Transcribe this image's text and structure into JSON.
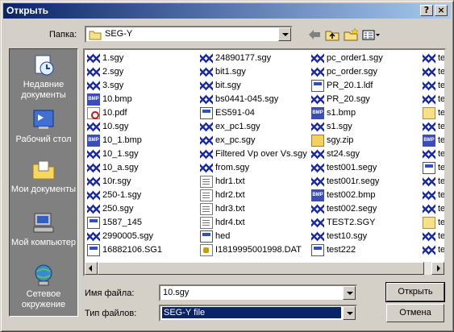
{
  "window": {
    "title": "Открыть",
    "help_label": "?",
    "close_label": "×"
  },
  "toolbar": {
    "lookin_label": "Папка:",
    "lookin_value": "SEG-Y"
  },
  "places": [
    {
      "label": "Недавние документы",
      "icon": "recent-docs-icon"
    },
    {
      "label": "Рабочий стол",
      "icon": "desktop-icon"
    },
    {
      "label": "Мои документы",
      "icon": "my-documents-icon"
    },
    {
      "label": "Мой компьютер",
      "icon": "my-computer-icon"
    },
    {
      "label": "Сетевое окружение",
      "icon": "network-icon"
    }
  ],
  "files": {
    "col1": [
      {
        "name": "1.sgy",
        "type": "sgy"
      },
      {
        "name": "2.sgy",
        "type": "sgy"
      },
      {
        "name": "3.sgy",
        "type": "sgy"
      },
      {
        "name": "10.bmp",
        "type": "bmp"
      },
      {
        "name": "10.pdf",
        "type": "pdf"
      },
      {
        "name": "10.sgy",
        "type": "sgy"
      },
      {
        "name": "10_1.bmp",
        "type": "bmp"
      },
      {
        "name": "10_1.sgy",
        "type": "sgy"
      },
      {
        "name": "10_a.sgy",
        "type": "sgy"
      },
      {
        "name": "10r.sgy",
        "type": "sgy"
      },
      {
        "name": "250-1.sgy",
        "type": "sgy"
      },
      {
        "name": "250.sgy",
        "type": "sgy"
      },
      {
        "name": "1587_145",
        "type": "gen"
      },
      {
        "name": "2990005.sgy",
        "type": "sgy"
      },
      {
        "name": "16882106.SG1",
        "type": "gen"
      }
    ],
    "col2": [
      {
        "name": "24890177.sgy",
        "type": "sgy"
      },
      {
        "name": "bit1.sgy",
        "type": "sgy"
      },
      {
        "name": "bit.sgy",
        "type": "sgy"
      },
      {
        "name": "bs0441-045.sgy",
        "type": "sgy"
      },
      {
        "name": "ES591-04",
        "type": "gen"
      },
      {
        "name": "ex_pc1.sgy",
        "type": "sgy"
      },
      {
        "name": "ex_pc.sgy",
        "type": "sgy"
      },
      {
        "name": "Filtered Vp over Vs.sgy",
        "type": "sgy"
      },
      {
        "name": "from.sgy",
        "type": "sgy"
      },
      {
        "name": "hdr1.txt",
        "type": "txt"
      },
      {
        "name": "hdr2.txt",
        "type": "txt"
      },
      {
        "name": "hdr3.txt",
        "type": "txt"
      },
      {
        "name": "hdr4.txt",
        "type": "txt"
      },
      {
        "name": "hed",
        "type": "gen"
      },
      {
        "name": "I1819995001998.DAT",
        "type": "dat"
      }
    ],
    "col3": [
      {
        "name": "pc_order1.sgy",
        "type": "sgy"
      },
      {
        "name": "pc_order.sgy",
        "type": "sgy"
      },
      {
        "name": "PR_20.1.ldf",
        "type": "gen"
      },
      {
        "name": "PR_20.sgy",
        "type": "sgy"
      },
      {
        "name": "s1.bmp",
        "type": "bmp"
      },
      {
        "name": "s1.sgy",
        "type": "sgy"
      },
      {
        "name": "sgy.zip",
        "type": "zip"
      },
      {
        "name": "st24.sgy",
        "type": "sgy"
      },
      {
        "name": "test001.segy",
        "type": "sgy"
      },
      {
        "name": "test001r.segy",
        "type": "sgy"
      },
      {
        "name": "test002.bmp",
        "type": "bmp"
      },
      {
        "name": "test002.segy",
        "type": "sgy"
      },
      {
        "name": "TEST2.SGY",
        "type": "sgy"
      },
      {
        "name": "test10.sgy",
        "type": "sgy"
      },
      {
        "name": "test222",
        "type": "gen"
      }
    ],
    "col4": [
      {
        "name": "tes",
        "type": "sgy"
      },
      {
        "name": "tes",
        "type": "sgy"
      },
      {
        "name": "tes",
        "type": "sgy"
      },
      {
        "name": "tes",
        "type": "sgy"
      },
      {
        "name": "tes",
        "type": "fold"
      },
      {
        "name": "tes",
        "type": "sgy"
      },
      {
        "name": "tes",
        "type": "bmp"
      },
      {
        "name": "tes",
        "type": "sgy"
      },
      {
        "name": "tes",
        "type": "gen"
      },
      {
        "name": "tes",
        "type": "sgy"
      },
      {
        "name": "tes",
        "type": "sgy"
      },
      {
        "name": "tes",
        "type": "sgy"
      },
      {
        "name": "tes",
        "type": "fold"
      },
      {
        "name": "tes",
        "type": "sgy"
      },
      {
        "name": "tes",
        "type": "sgy"
      }
    ]
  },
  "filename": {
    "label": "Имя файла:",
    "value": "10.sgy"
  },
  "filetype": {
    "label": "Тип файлов:",
    "value": "SEG-Y file"
  },
  "buttons": {
    "open": "Открыть",
    "cancel": "Отмена"
  },
  "colors": {
    "title_start": "#0a246a",
    "title_end": "#a6caf0",
    "selection": "#0a246a",
    "places_bg": "#808080"
  }
}
